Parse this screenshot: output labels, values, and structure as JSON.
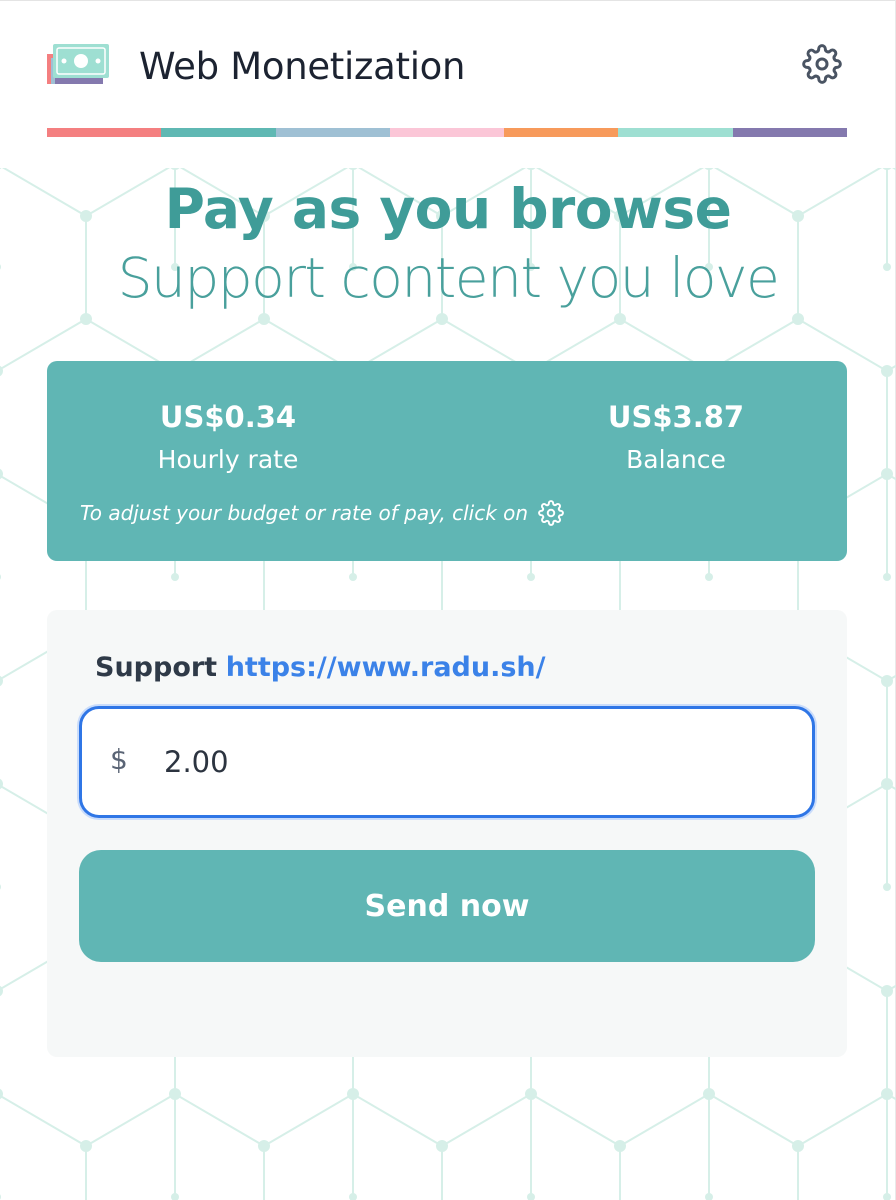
{
  "header": {
    "title": "Web Monetization",
    "logo_icon": "money-bill-icon",
    "settings_icon": "gear-icon"
  },
  "stripe_colors": [
    "#f47f80",
    "#5fb8b3",
    "#9fc0d4",
    "#fbc6d7",
    "#f79a5b",
    "#9edfd2",
    "#8479ae"
  ],
  "hero": {
    "title": "Pay as you browse",
    "subtitle": "Support content you love"
  },
  "stats": {
    "hourly_rate_value": "US$0.34",
    "hourly_rate_label": "Hourly rate",
    "balance_value": "US$3.87",
    "balance_label": "Balance",
    "hint": "To adjust your budget or rate of pay, click on"
  },
  "support": {
    "prefix": "Support",
    "site_url": "https://www.radu.sh/",
    "currency_symbol": "$",
    "amount": "2.00",
    "send_label": "Send now"
  },
  "colors": {
    "accent": "#60b6b4",
    "hero_text": "#3f9c98",
    "link": "#3b82e8",
    "focus_ring": "#2f76e6"
  }
}
